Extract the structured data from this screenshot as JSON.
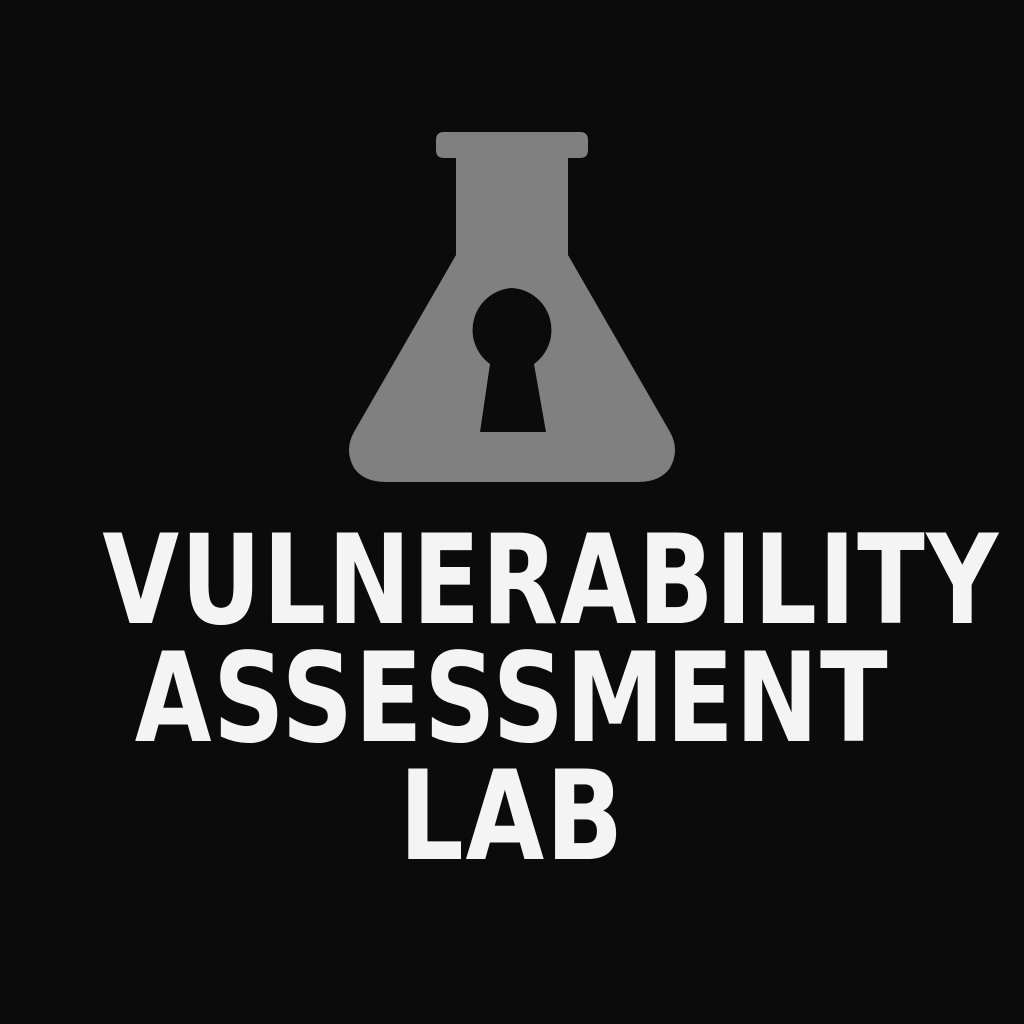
{
  "logo": {
    "icon": "flask-keyhole-icon",
    "title_lines": [
      "VULNERABILITY",
      "ASSESSMENT",
      "LAB"
    ],
    "colors": {
      "background": "#0b0b0b",
      "flask": "#808080",
      "keyhole": "#0b0b0b",
      "text": "#f4f4f4"
    }
  }
}
